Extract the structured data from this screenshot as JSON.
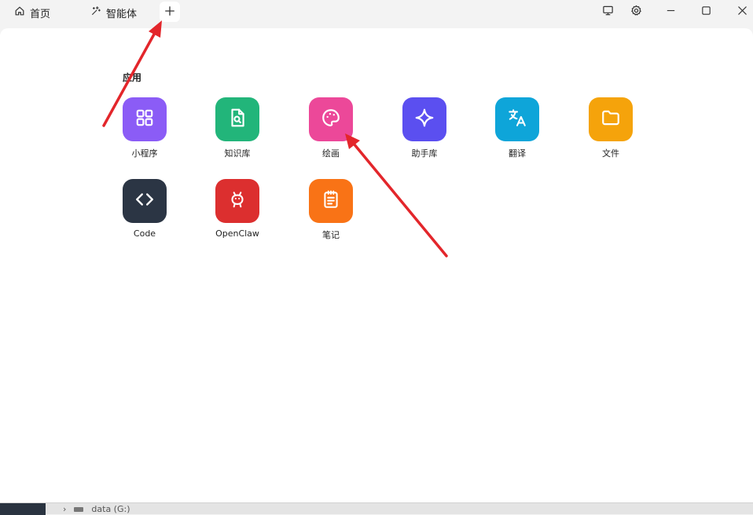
{
  "titlebar": {
    "tabs": [
      {
        "label": "首页",
        "icon": "home-icon"
      },
      {
        "label": "智能体",
        "icon": "sparkle-icon"
      }
    ],
    "add_tab_icon": "plus-icon",
    "right_buttons": [
      "monitor-icon",
      "gear-icon",
      "minimize-icon",
      "maximize-icon",
      "close-icon"
    ]
  },
  "section": {
    "title": "应用"
  },
  "apps": [
    {
      "label": "小程序",
      "icon": "grid-icon",
      "color": "#8b5cf6"
    },
    {
      "label": "知识库",
      "icon": "file-search-icon",
      "color": "#22b57a"
    },
    {
      "label": "绘画",
      "icon": "palette-icon",
      "color": "#ec4899"
    },
    {
      "label": "助手库",
      "icon": "sparkle-icon",
      "color": "#5b4ff0"
    },
    {
      "label": "翻译",
      "icon": "translate-icon",
      "color": "#0ea5d9"
    },
    {
      "label": "文件",
      "icon": "folder-icon",
      "color": "#f5a30b"
    },
    {
      "label": "Code",
      "icon": "code-icon",
      "color": "#2b3544"
    },
    {
      "label": "OpenClaw",
      "icon": "crab-icon",
      "color": "#dc2f2f"
    },
    {
      "label": "笔记",
      "icon": "notepad-icon",
      "color": "#f97316"
    }
  ],
  "taskbar": {
    "item_label": "data (G:)"
  },
  "annotation_color": "#e3262b"
}
